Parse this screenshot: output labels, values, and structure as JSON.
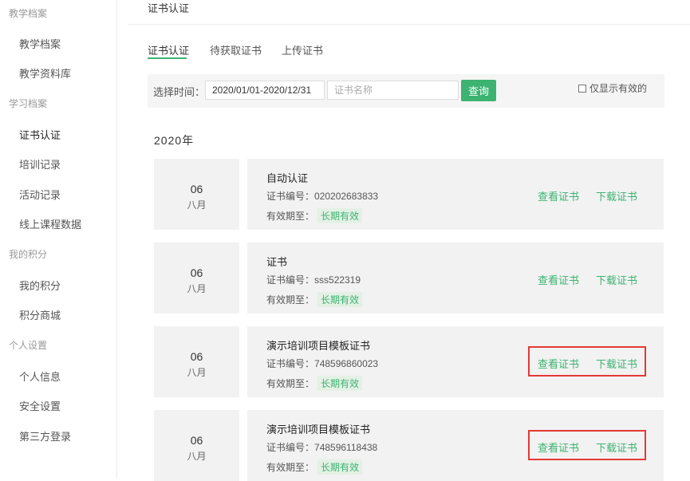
{
  "sidebar": {
    "groups": [
      {
        "label": "教学档案",
        "items": [
          "教学档案",
          "教学资料库"
        ]
      },
      {
        "label": "学习档案",
        "items": [
          "证书认证",
          "培训记录",
          "活动记录",
          "线上课程数据"
        ]
      },
      {
        "label": "我的积分",
        "items": [
          "我的积分",
          "积分商城"
        ]
      },
      {
        "label": "个人设置",
        "items": [
          "个人信息",
          "安全设置",
          "第三方登录"
        ]
      }
    ],
    "active_item": "证书认证"
  },
  "breadcrumb": "证书认证",
  "tabs": [
    {
      "label": "证书认证",
      "active": true
    },
    {
      "label": "待获取证书",
      "active": false
    },
    {
      "label": "上传证书",
      "active": false
    }
  ],
  "filter": {
    "time_label": "选择时间：",
    "date_range_value": "2020/01/01-2020/12/31",
    "name_placeholder": "证书名称",
    "query_label": "查询",
    "only_valid_label": "仅显示有效的"
  },
  "year_heading": "2020年",
  "labels": {
    "cert_no": "证书编号：",
    "valid_until": "有效期至：",
    "view": "查看证书",
    "download": "下载证书"
  },
  "certificates": [
    {
      "day": "06",
      "month": "八月",
      "name": "自动认证",
      "number": "020202683833",
      "validity": "长期有效",
      "highlighted": false
    },
    {
      "day": "06",
      "month": "八月",
      "name": "证书",
      "number": "sss522319",
      "validity": "长期有效",
      "highlighted": false
    },
    {
      "day": "06",
      "month": "八月",
      "name": "演示培训项目模板证书",
      "number": "748596860023",
      "validity": "长期有效",
      "highlighted": true
    },
    {
      "day": "06",
      "month": "八月",
      "name": "演示培训项目模板证书",
      "number": "748596118438",
      "validity": "长期有效",
      "highlighted": true
    }
  ],
  "colors": {
    "accent": "#3cb371",
    "highlight": "#e53935"
  }
}
